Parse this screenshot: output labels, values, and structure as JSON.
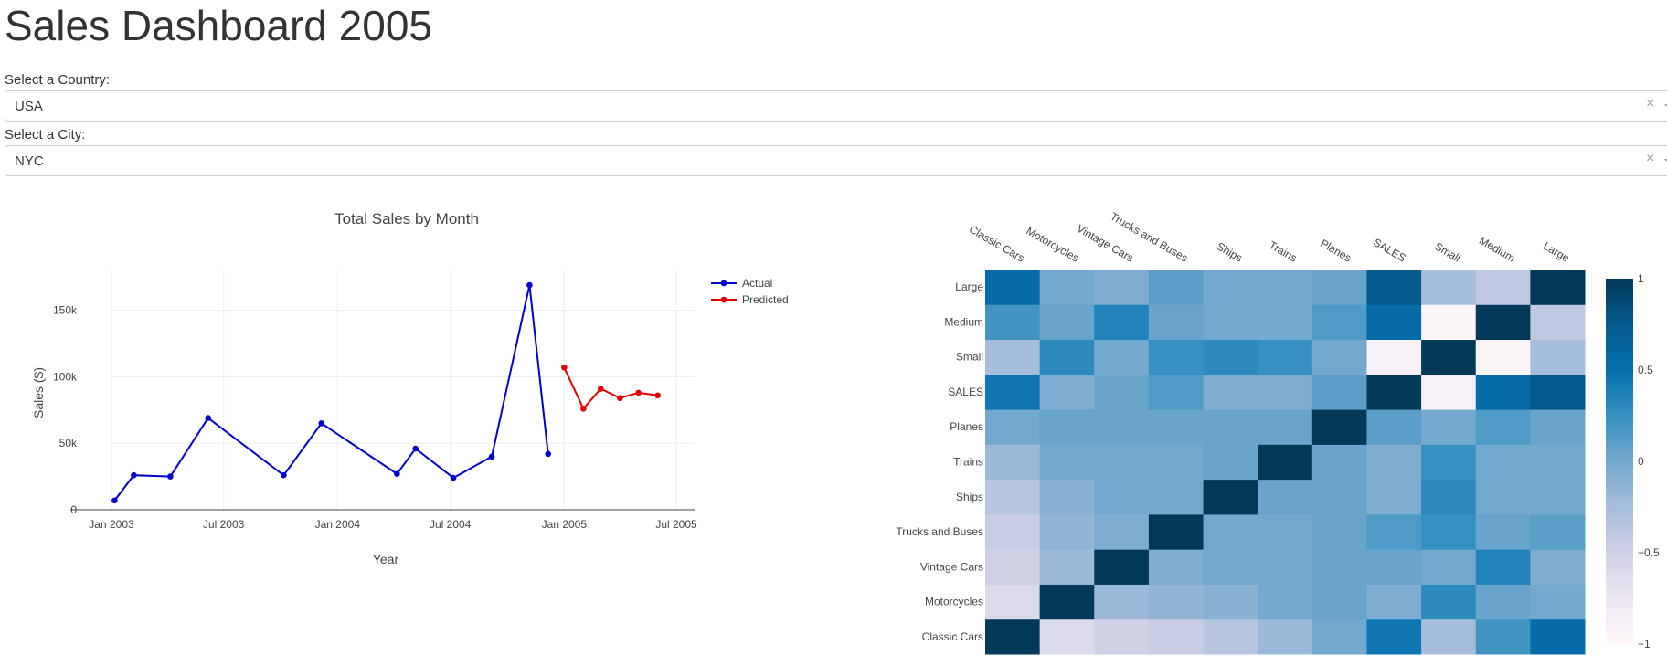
{
  "page": {
    "title": "Sales Dashboard 2005"
  },
  "filters": {
    "country": {
      "label": "Select a Country:",
      "value": "USA",
      "clear_icon": "×"
    },
    "city": {
      "label": "Select a City:",
      "value": "NYC",
      "clear_icon": "×"
    }
  },
  "chart_data": [
    {
      "type": "line",
      "title": "Total Sales by Month",
      "xlabel": "Year",
      "ylabel": "Sales ($)",
      "x_ticks": [
        "Jan 2003",
        "Jul 2003",
        "Jan 2004",
        "Jul 2004",
        "Jan 2005",
        "Jul 2005"
      ],
      "y_ticks": [
        "0",
        "50k",
        "100k",
        "150k"
      ],
      "ylim": [
        0,
        180000
      ],
      "grid": true,
      "legend_position": "top-right",
      "series": [
        {
          "name": "Actual",
          "color": "#0000cc",
          "points": [
            {
              "x": "2003-01-06",
              "y": 7000
            },
            {
              "x": "2003-02-06",
              "y": 26000
            },
            {
              "x": "2003-04-06",
              "y": 25000
            },
            {
              "x": "2003-06-06",
              "y": 69000
            },
            {
              "x": "2003-10-06",
              "y": 26000
            },
            {
              "x": "2003-12-06",
              "y": 65000
            },
            {
              "x": "2004-04-06",
              "y": 27000
            },
            {
              "x": "2004-05-06",
              "y": 46000
            },
            {
              "x": "2004-07-06",
              "y": 24000
            },
            {
              "x": "2004-09-06",
              "y": 40000
            },
            {
              "x": "2004-11-06",
              "y": 169000
            },
            {
              "x": "2004-12-06",
              "y": 42000
            }
          ]
        },
        {
          "name": "Predicted",
          "color": "#e00000",
          "points": [
            {
              "x": "2005-01-01",
              "y": 107000
            },
            {
              "x": "2005-02-01",
              "y": 76000
            },
            {
              "x": "2005-03-01",
              "y": 91000
            },
            {
              "x": "2005-04-01",
              "y": 84000
            },
            {
              "x": "2005-05-01",
              "y": 88000
            },
            {
              "x": "2005-06-01",
              "y": 86000
            }
          ]
        }
      ]
    },
    {
      "type": "heatmap",
      "x_categories": [
        "Classic Cars",
        "Motorcycles",
        "Vintage Cars",
        "Trucks and Buses",
        "Ships",
        "Trains",
        "Planes",
        "SALES",
        "Small",
        "Medium",
        "Large"
      ],
      "y_categories": [
        "Classic Cars",
        "Motorcycles",
        "Vintage Cars",
        "Trucks and Buses",
        "Ships",
        "Trains",
        "Planes",
        "SALES",
        "Small",
        "Medium",
        "Large"
      ],
      "zlim": [
        -1,
        1
      ],
      "colorbar_ticks": [
        "1",
        "0.5",
        "0",
        "−0.5",
        "−1"
      ],
      "colorscale": [
        "#fff7fb",
        "#ece7f2",
        "#d0d1e6",
        "#a6bddb",
        "#74a9cf",
        "#3690c0",
        "#0570b0",
        "#045a8d",
        "#023858"
      ],
      "z": [
        [
          1,
          -0.6,
          -0.5,
          -0.45,
          -0.35,
          -0.2,
          0,
          0.45,
          -0.25,
          0.2,
          0.55
        ],
        [
          -0.6,
          1,
          -0.2,
          -0.15,
          -0.1,
          0,
          0.05,
          -0.05,
          0.3,
          0.05,
          0
        ],
        [
          -0.5,
          -0.2,
          1,
          -0.05,
          0,
          0,
          0.05,
          0.05,
          0,
          0.35,
          -0.05
        ],
        [
          -0.45,
          -0.15,
          -0.05,
          1,
          0,
          0,
          0.05,
          0.15,
          0.25,
          0.05,
          0.1
        ],
        [
          -0.35,
          -0.1,
          0,
          0,
          1,
          0.05,
          0.05,
          -0.05,
          0.3,
          0,
          0
        ],
        [
          -0.2,
          0,
          0,
          0,
          0.05,
          1,
          0.05,
          -0.05,
          0.25,
          0,
          0
        ],
        [
          0,
          0.05,
          0.05,
          0.05,
          0.05,
          0.05,
          1,
          0.1,
          0,
          0.15,
          0.05
        ],
        [
          0.45,
          -0.05,
          0.05,
          0.15,
          -0.05,
          -0.05,
          0.1,
          1,
          -0.9,
          0.55,
          0.75
        ],
        [
          -0.25,
          0.3,
          0,
          0.25,
          0.3,
          0.25,
          0,
          -0.9,
          1,
          -0.95,
          -0.25
        ],
        [
          0.2,
          0.05,
          0.35,
          0.05,
          0,
          0,
          0.15,
          0.55,
          -0.95,
          1,
          -0.4
        ],
        [
          0.55,
          0,
          -0.05,
          0.1,
          0,
          0,
          0.05,
          0.75,
          -0.25,
          -0.4,
          1
        ]
      ]
    }
  ]
}
